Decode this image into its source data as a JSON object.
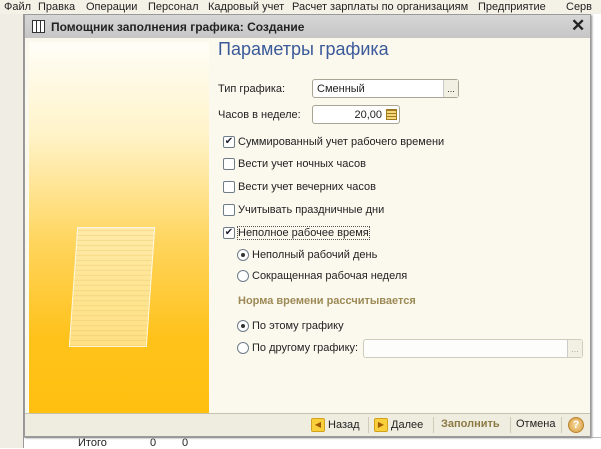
{
  "background": {
    "menu": [
      "Файл",
      "Правка",
      "Операции",
      "Персонал",
      "Кадровый учет",
      "Расчет зарплаты по организациям",
      "Предприятие",
      "Серв"
    ],
    "grid_row": {
      "label": "Итого",
      "v1": "0",
      "v2": "0"
    }
  },
  "dialog": {
    "title": "Помощник заполнения графика: Создание",
    "heading": "Параметры графика",
    "schedule_type": {
      "label": "Тип графика:",
      "value": "Сменный"
    },
    "hours_per_week": {
      "label": "Часов в неделе:",
      "value": "20,00"
    },
    "checkboxes": [
      {
        "label": "Суммированный учет рабочего времени",
        "checked": true
      },
      {
        "label": "Вести учет ночных часов",
        "checked": false
      },
      {
        "label": "Вести учет вечерних часов",
        "checked": false
      },
      {
        "label": "Учитывать праздничные дни",
        "checked": false
      },
      {
        "label": "Неполное рабочее время",
        "checked": true
      }
    ],
    "part_time": [
      {
        "label": "Неполный рабочий день",
        "selected": true
      },
      {
        "label": "Сокращенная рабочая неделя",
        "selected": false
      }
    ],
    "norm_section": "Норма времени рассчитывается",
    "norm": [
      {
        "label": "По этому графику",
        "selected": true
      },
      {
        "label": "По другому графику:",
        "selected": false,
        "value": ""
      }
    ],
    "buttons": {
      "back": "Назад",
      "next": "Далее",
      "fill": "Заполнить",
      "cancel": "Отмена",
      "help": "?"
    }
  },
  "colors": {
    "accent": "#3b5a9a",
    "banner": "#ffc21a"
  }
}
